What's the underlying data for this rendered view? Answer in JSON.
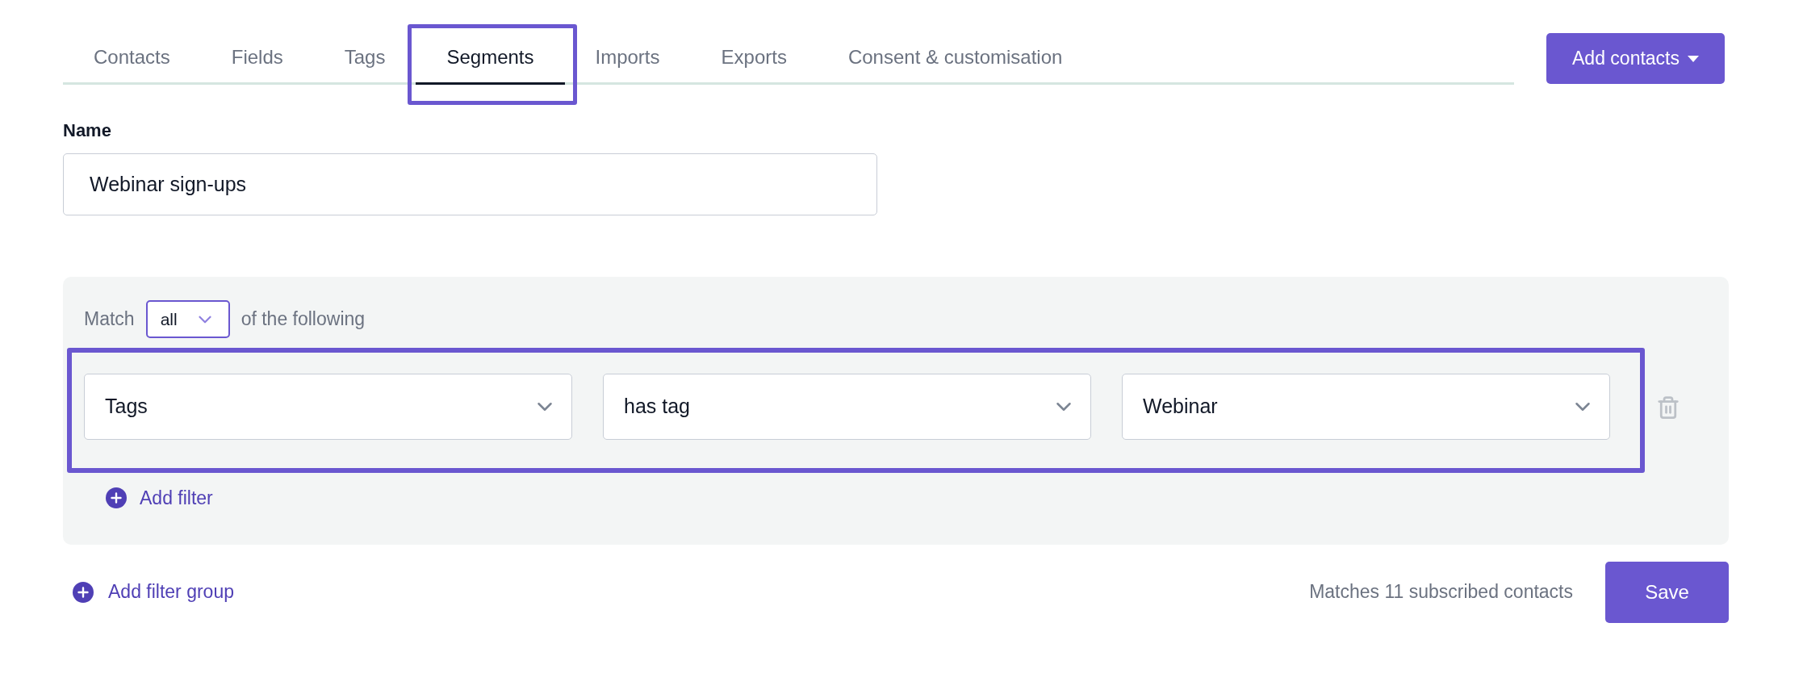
{
  "tabs": [
    {
      "label": "Contacts",
      "selected": false,
      "highlighted": false
    },
    {
      "label": "Fields",
      "selected": false,
      "highlighted": false
    },
    {
      "label": "Tags",
      "selected": false,
      "highlighted": false
    },
    {
      "label": "Segments",
      "selected": true,
      "highlighted": true
    },
    {
      "label": "Imports",
      "selected": false,
      "highlighted": false
    },
    {
      "label": "Exports",
      "selected": false,
      "highlighted": false
    },
    {
      "label": "Consent & customisation",
      "selected": false,
      "highlighted": false
    }
  ],
  "add_contacts_button": {
    "label": "Add contacts"
  },
  "name_field": {
    "label": "Name",
    "value": "Webinar sign-ups"
  },
  "filter_group": {
    "match_label": "Match",
    "match_value": "all",
    "match_suffix": "of the following",
    "filters": [
      {
        "highlighted": true,
        "selects": [
          "Tags",
          "has tag",
          "Webinar"
        ]
      }
    ],
    "add_filter": "Add filter"
  },
  "add_filter_group": "Add filter group",
  "match_count": "Matches 11 subscribed contacts",
  "save_button": "Save"
}
